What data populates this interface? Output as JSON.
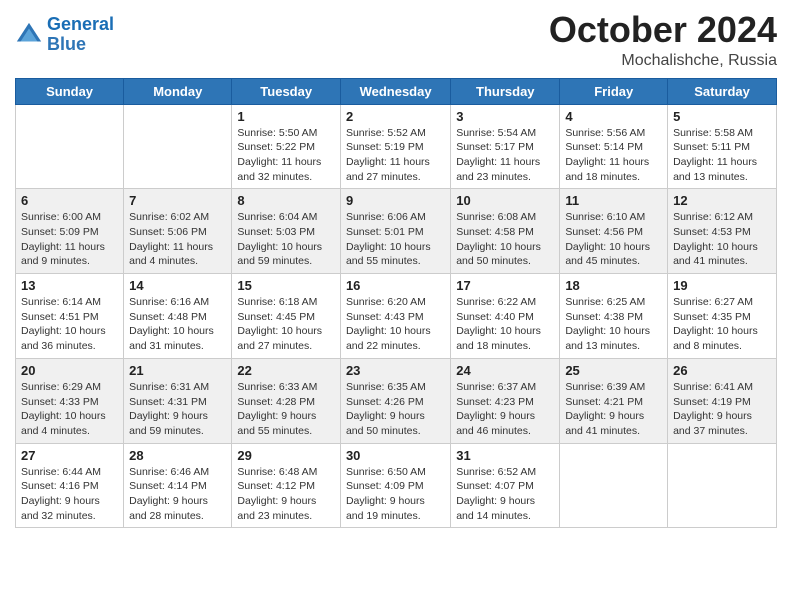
{
  "header": {
    "logo_line1": "General",
    "logo_line2": "Blue",
    "month": "October 2024",
    "location": "Mochalishche, Russia"
  },
  "weekdays": [
    "Sunday",
    "Monday",
    "Tuesday",
    "Wednesday",
    "Thursday",
    "Friday",
    "Saturday"
  ],
  "weeks": [
    [
      {
        "day": "",
        "info": ""
      },
      {
        "day": "",
        "info": ""
      },
      {
        "day": "1",
        "info": "Sunrise: 5:50 AM\nSunset: 5:22 PM\nDaylight: 11 hours\nand 32 minutes."
      },
      {
        "day": "2",
        "info": "Sunrise: 5:52 AM\nSunset: 5:19 PM\nDaylight: 11 hours\nand 27 minutes."
      },
      {
        "day": "3",
        "info": "Sunrise: 5:54 AM\nSunset: 5:17 PM\nDaylight: 11 hours\nand 23 minutes."
      },
      {
        "day": "4",
        "info": "Sunrise: 5:56 AM\nSunset: 5:14 PM\nDaylight: 11 hours\nand 18 minutes."
      },
      {
        "day": "5",
        "info": "Sunrise: 5:58 AM\nSunset: 5:11 PM\nDaylight: 11 hours\nand 13 minutes."
      }
    ],
    [
      {
        "day": "6",
        "info": "Sunrise: 6:00 AM\nSunset: 5:09 PM\nDaylight: 11 hours\nand 9 minutes."
      },
      {
        "day": "7",
        "info": "Sunrise: 6:02 AM\nSunset: 5:06 PM\nDaylight: 11 hours\nand 4 minutes."
      },
      {
        "day": "8",
        "info": "Sunrise: 6:04 AM\nSunset: 5:03 PM\nDaylight: 10 hours\nand 59 minutes."
      },
      {
        "day": "9",
        "info": "Sunrise: 6:06 AM\nSunset: 5:01 PM\nDaylight: 10 hours\nand 55 minutes."
      },
      {
        "day": "10",
        "info": "Sunrise: 6:08 AM\nSunset: 4:58 PM\nDaylight: 10 hours\nand 50 minutes."
      },
      {
        "day": "11",
        "info": "Sunrise: 6:10 AM\nSunset: 4:56 PM\nDaylight: 10 hours\nand 45 minutes."
      },
      {
        "day": "12",
        "info": "Sunrise: 6:12 AM\nSunset: 4:53 PM\nDaylight: 10 hours\nand 41 minutes."
      }
    ],
    [
      {
        "day": "13",
        "info": "Sunrise: 6:14 AM\nSunset: 4:51 PM\nDaylight: 10 hours\nand 36 minutes."
      },
      {
        "day": "14",
        "info": "Sunrise: 6:16 AM\nSunset: 4:48 PM\nDaylight: 10 hours\nand 31 minutes."
      },
      {
        "day": "15",
        "info": "Sunrise: 6:18 AM\nSunset: 4:45 PM\nDaylight: 10 hours\nand 27 minutes."
      },
      {
        "day": "16",
        "info": "Sunrise: 6:20 AM\nSunset: 4:43 PM\nDaylight: 10 hours\nand 22 minutes."
      },
      {
        "day": "17",
        "info": "Sunrise: 6:22 AM\nSunset: 4:40 PM\nDaylight: 10 hours\nand 18 minutes."
      },
      {
        "day": "18",
        "info": "Sunrise: 6:25 AM\nSunset: 4:38 PM\nDaylight: 10 hours\nand 13 minutes."
      },
      {
        "day": "19",
        "info": "Sunrise: 6:27 AM\nSunset: 4:35 PM\nDaylight: 10 hours\nand 8 minutes."
      }
    ],
    [
      {
        "day": "20",
        "info": "Sunrise: 6:29 AM\nSunset: 4:33 PM\nDaylight: 10 hours\nand 4 minutes."
      },
      {
        "day": "21",
        "info": "Sunrise: 6:31 AM\nSunset: 4:31 PM\nDaylight: 9 hours\nand 59 minutes."
      },
      {
        "day": "22",
        "info": "Sunrise: 6:33 AM\nSunset: 4:28 PM\nDaylight: 9 hours\nand 55 minutes."
      },
      {
        "day": "23",
        "info": "Sunrise: 6:35 AM\nSunset: 4:26 PM\nDaylight: 9 hours\nand 50 minutes."
      },
      {
        "day": "24",
        "info": "Sunrise: 6:37 AM\nSunset: 4:23 PM\nDaylight: 9 hours\nand 46 minutes."
      },
      {
        "day": "25",
        "info": "Sunrise: 6:39 AM\nSunset: 4:21 PM\nDaylight: 9 hours\nand 41 minutes."
      },
      {
        "day": "26",
        "info": "Sunrise: 6:41 AM\nSunset: 4:19 PM\nDaylight: 9 hours\nand 37 minutes."
      }
    ],
    [
      {
        "day": "27",
        "info": "Sunrise: 6:44 AM\nSunset: 4:16 PM\nDaylight: 9 hours\nand 32 minutes."
      },
      {
        "day": "28",
        "info": "Sunrise: 6:46 AM\nSunset: 4:14 PM\nDaylight: 9 hours\nand 28 minutes."
      },
      {
        "day": "29",
        "info": "Sunrise: 6:48 AM\nSunset: 4:12 PM\nDaylight: 9 hours\nand 23 minutes."
      },
      {
        "day": "30",
        "info": "Sunrise: 6:50 AM\nSunset: 4:09 PM\nDaylight: 9 hours\nand 19 minutes."
      },
      {
        "day": "31",
        "info": "Sunrise: 6:52 AM\nSunset: 4:07 PM\nDaylight: 9 hours\nand 14 minutes."
      },
      {
        "day": "",
        "info": ""
      },
      {
        "day": "",
        "info": ""
      }
    ]
  ]
}
